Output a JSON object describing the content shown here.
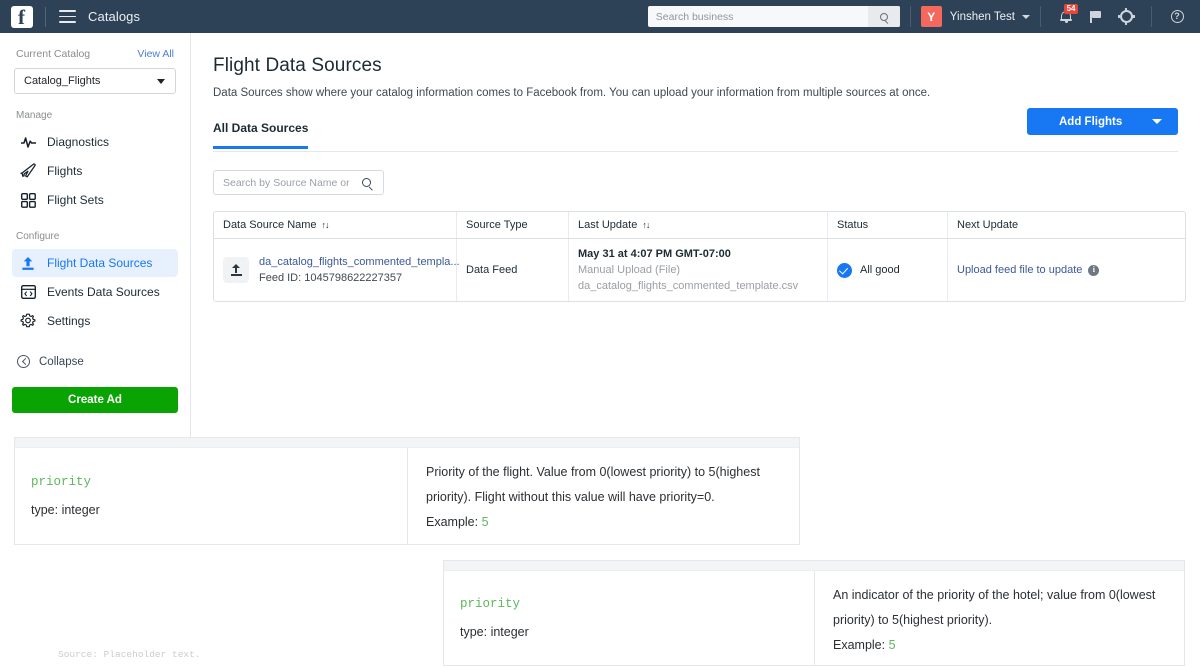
{
  "topbar": {
    "logo": "facebook-f-logo",
    "menu_icon": "hamburger-menu-icon",
    "app_title": "Catalogs",
    "search_placeholder": "Search business",
    "search_value": "",
    "search_icon": "search-icon",
    "avatar_initial": "Y",
    "user_name": "Yinshen Test",
    "notifications_badge": "54",
    "bell_icon": "bell-icon",
    "flag_icon": "flag-icon",
    "gear_icon": "gear-icon",
    "help_icon": "help-icon",
    "bg_color": "#2d4256",
    "avatar_color": "#f4685e",
    "badge_color": "#e8443a"
  },
  "sidebar": {
    "current_catalog_label": "Current Catalog",
    "view_all_label": "View All",
    "catalog_value": "Catalog_Flights",
    "sections": [
      {
        "label": "Manage",
        "items": [
          {
            "label": "Diagnostics",
            "icon": "pulse-icon",
            "active": false
          },
          {
            "label": "Flights",
            "icon": "airplane-icon",
            "active": false
          },
          {
            "label": "Flight Sets",
            "icon": "grid-icon",
            "active": false
          }
        ]
      },
      {
        "label": "Configure",
        "items": [
          {
            "label": "Flight Data Sources",
            "icon": "upload-icon",
            "active": true
          },
          {
            "label": "Events Data Sources",
            "icon": "code-window-icon",
            "active": false
          },
          {
            "label": "Settings",
            "icon": "gear-icon",
            "active": false
          }
        ]
      }
    ],
    "collapse_label": "Collapse",
    "collapse_icon": "chevron-left-circle-icon",
    "create_ad_label": "Create Ad",
    "create_ad_color": "#09a404",
    "active_color": "#1877f2"
  },
  "main": {
    "title": "Flight Data Sources",
    "subtitle": "Data Sources show where your catalog information comes to Facebook from. You can upload your information from multiple sources at once.",
    "tab_label": "All Data Sources",
    "add_button_label": "Add Flights",
    "add_button_color": "#1877f2",
    "search_placeholder": "Search by Source Name or ID",
    "search_value": "",
    "table": {
      "headers": [
        {
          "label": "Data Source Name",
          "sortable": true,
          "sort_icon": "↑↓"
        },
        {
          "label": "Source Type",
          "sortable": false,
          "sort_icon": ""
        },
        {
          "label": "Last Update",
          "sortable": true,
          "sort_icon": "↑↓"
        },
        {
          "label": "Status",
          "sortable": false,
          "sort_icon": ""
        },
        {
          "label": "Next Update",
          "sortable": false,
          "sort_icon": ""
        }
      ],
      "rows": [
        {
          "icon": "upload-icon",
          "name": "da_catalog_flights_commented_templa...",
          "feed_id": "Feed ID: 1045798622227357",
          "source_type": "Data Feed",
          "last_update_time": "May 31 at 4:07 PM GMT-07:00",
          "last_update_method": "Manual Upload (File)",
          "last_update_file": "da_catalog_flights_commented_template.csv",
          "status": "All good",
          "status_icon": "check-circle-icon",
          "next_update": "Upload feed file to update",
          "next_update_info_icon": "info-icon"
        }
      ]
    }
  },
  "doc_panels": [
    {
      "key": "priority",
      "type": "type: integer",
      "description": "Priority of the flight. Value from 0(lowest priority) to 5(highest priority). Flight without this value will have priority=0.",
      "example_label": "Example:",
      "example_value": "5"
    },
    {
      "key": "priority",
      "type": "type: integer",
      "description": "An indicator of the priority of the hotel; value from 0(lowest priority) to 5(highest priority).",
      "example_label": "Example:",
      "example_value": "5"
    }
  ],
  "source_note": "Source: Placeholder text."
}
